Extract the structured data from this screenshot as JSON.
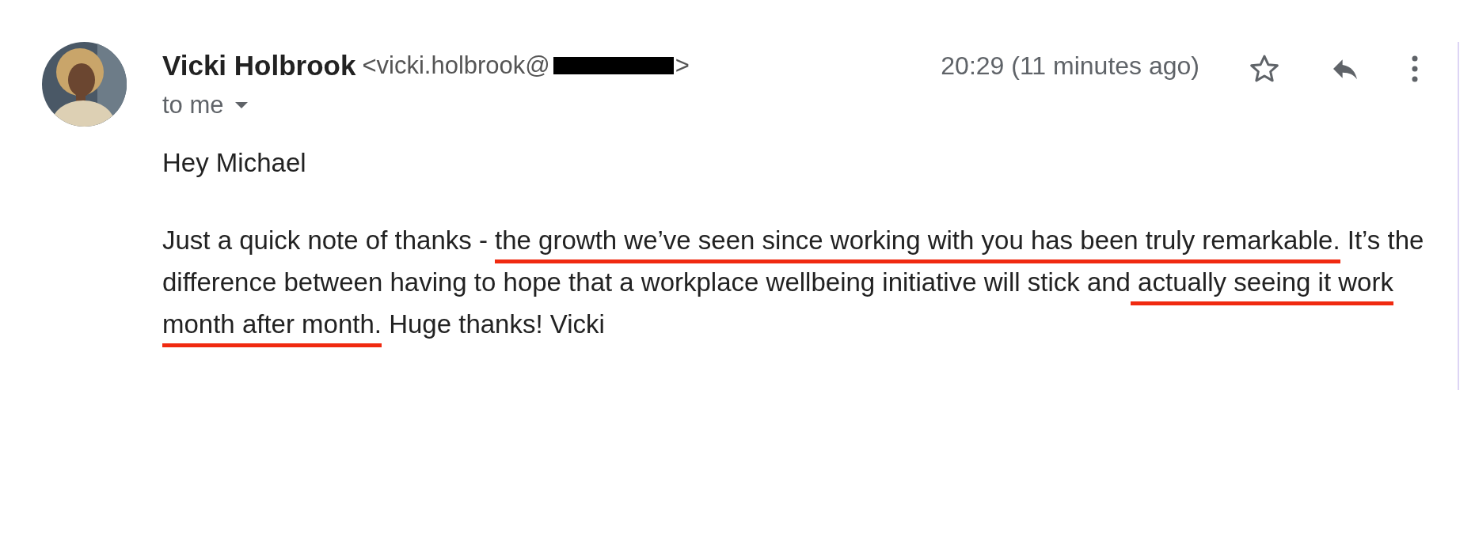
{
  "sender": {
    "name": "Vicki Holbrook",
    "email_start": "<vicki.holbrook@",
    "email_redacted": true,
    "email_end": ">"
  },
  "recipient": {
    "label": "to me"
  },
  "time": "20:29 (11 minutes ago)",
  "starred": false,
  "body": {
    "greeting": "Hey Michael",
    "segments": [
      {
        "text": "Just a quick note of thanks - ",
        "underlined": false
      },
      {
        "text": "the growth we’ve seen since working with you has been truly remarkable.",
        "underlined": true
      },
      {
        "text": " It’s the difference between having to hope that a workplace wellbeing initiative will stick and",
        "underlined": false
      },
      {
        "text": " actually seeing it work month after month.",
        "underlined": true
      },
      {
        "text": " Huge thanks! Vicki",
        "underlined": false
      }
    ]
  }
}
